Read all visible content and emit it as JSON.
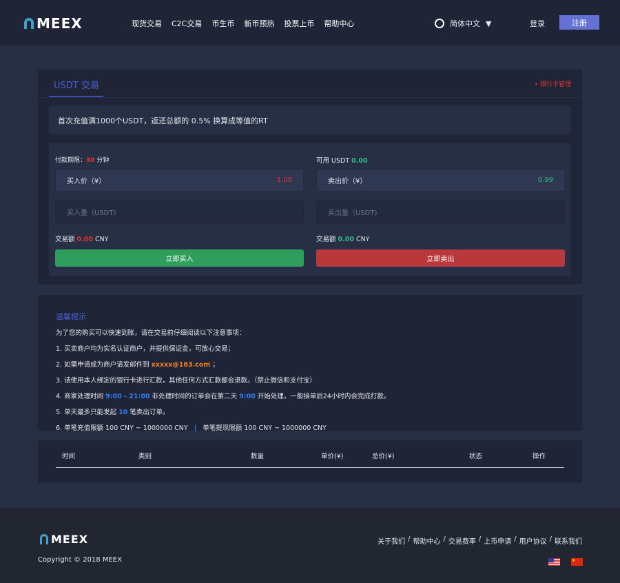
{
  "header": {
    "logo": "MEEX",
    "nav": [
      "现货交易",
      "C2C交易",
      "币生币",
      "新币预热",
      "投票上币",
      "帮助中心"
    ],
    "language": "简体中文",
    "login": "登录",
    "register": "注册"
  },
  "trade": {
    "tab": "USDT 交易",
    "bank_link": "• 银行卡管理",
    "promo": "首次充值满1000个USDT，返还总额的 0.5% 换算成等值的RT",
    "buy": {
      "limit_label": "付款期限：",
      "limit_value": "30",
      "limit_unit": "分钟",
      "price_label": "买入价（¥）",
      "price": "1.00",
      "qty_placeholder": "买入量（USDT)",
      "amount_label": "交易额",
      "amount": "0.00",
      "currency": "CNY",
      "button": "立即买入"
    },
    "sell": {
      "avail_label": "可用 USDT",
      "avail": "0.00",
      "price_label": "卖出价（¥）",
      "price": "0.99",
      "qty_placeholder": "卖出量（USDT)",
      "amount_label": "交易额",
      "amount": "0.00",
      "currency": "CNY",
      "button": "立即卖出"
    }
  },
  "tips": {
    "title": "温馨提示",
    "intro": "为了您的购买可以快速到账，请在交易前仔细阅读以下注意事项：",
    "l1": "1. 买卖商户均为实名认证商户，并提供保证金，可放心交易；",
    "l2a": "2. 如需申请成为商户请发邮件到 ",
    "l2email": "xxxxx@163.com",
    "l2b": " ；",
    "l3": "3. 请使用本人绑定的银行卡进行汇款，其他任何方式汇款都会退款。（禁止微信和支付宝）",
    "l4a": "4. 商家处理时间 ",
    "l4t1": "9:00 - 21:00",
    "l4b": " 非处理时间的订单会在第二天 ",
    "l4t2": "9:00",
    "l4c": " 开始处理，一般接单后24小时内会完成打款。",
    "l5a": "5. 单天最多只能发起 ",
    "l5n": "10",
    "l5b": " 笔卖出订单。",
    "l6a": "6. 单笔充值限额 100 CNY ~ 1000000 CNY",
    "l6sep": "|",
    "l6b": "单笔提现限额 100 CNY ~ 1000000 CNY"
  },
  "table": {
    "headers": [
      "时间",
      "类别",
      "数量",
      "单价(¥)",
      "总价(¥)",
      "状态",
      "操作"
    ]
  },
  "footer": {
    "logo": "MEEX",
    "copyright": "Copyright © 2018 MEEX",
    "links": [
      "关于我们",
      "帮助中心",
      "交易费率",
      "上币申请",
      "用户协议",
      "联系我们"
    ]
  }
}
